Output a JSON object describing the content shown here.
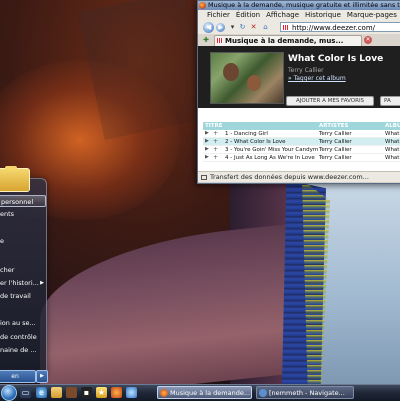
{
  "browser": {
    "title": "Musique à la demande, musique gratuite et illimitée sans téléchargement",
    "menu": [
      "Fichier",
      "Édition",
      "Affichage",
      "Historique",
      "Marque-pages"
    ],
    "url": "http://www.deezer.com/",
    "tab_label": "Musique à la demande, mus...",
    "status": "Transfert des données depuis www.deezer.com..."
  },
  "player": {
    "song_title": "What Color Is Love",
    "artist": "Terry Callier",
    "tag_link": "» Tagger cet album",
    "fav_button": "AJOUTER A MES FAVORIS",
    "second_button": "PA",
    "columns": [
      "TITRE",
      "ARTISTES",
      "ALBUM"
    ],
    "tracks": [
      {
        "name": "1 - Dancing Girl",
        "artist": "Terry Callier",
        "album": "What"
      },
      {
        "name": "2 - What Color Is Love",
        "artist": "Terry Callier",
        "album": "What"
      },
      {
        "name": "3 - You're Goin' Miss Your Candym",
        "artist": "Terry Callier",
        "album": "What"
      },
      {
        "name": "4 - Just As Long As We're In Love",
        "artist": "Terry Callier",
        "album": "What"
      }
    ]
  },
  "start_menu": {
    "items": [
      "personnel",
      "ents",
      "e",
      "cher",
      "er l'histori...",
      "de travail",
      "ion au se...",
      "de contrôle",
      "naine de ..."
    ],
    "shutdown_label": "en"
  },
  "taskbar": {
    "tasks": [
      "Musique à la demande...",
      "[nemmeth - Navigate..."
    ]
  }
}
